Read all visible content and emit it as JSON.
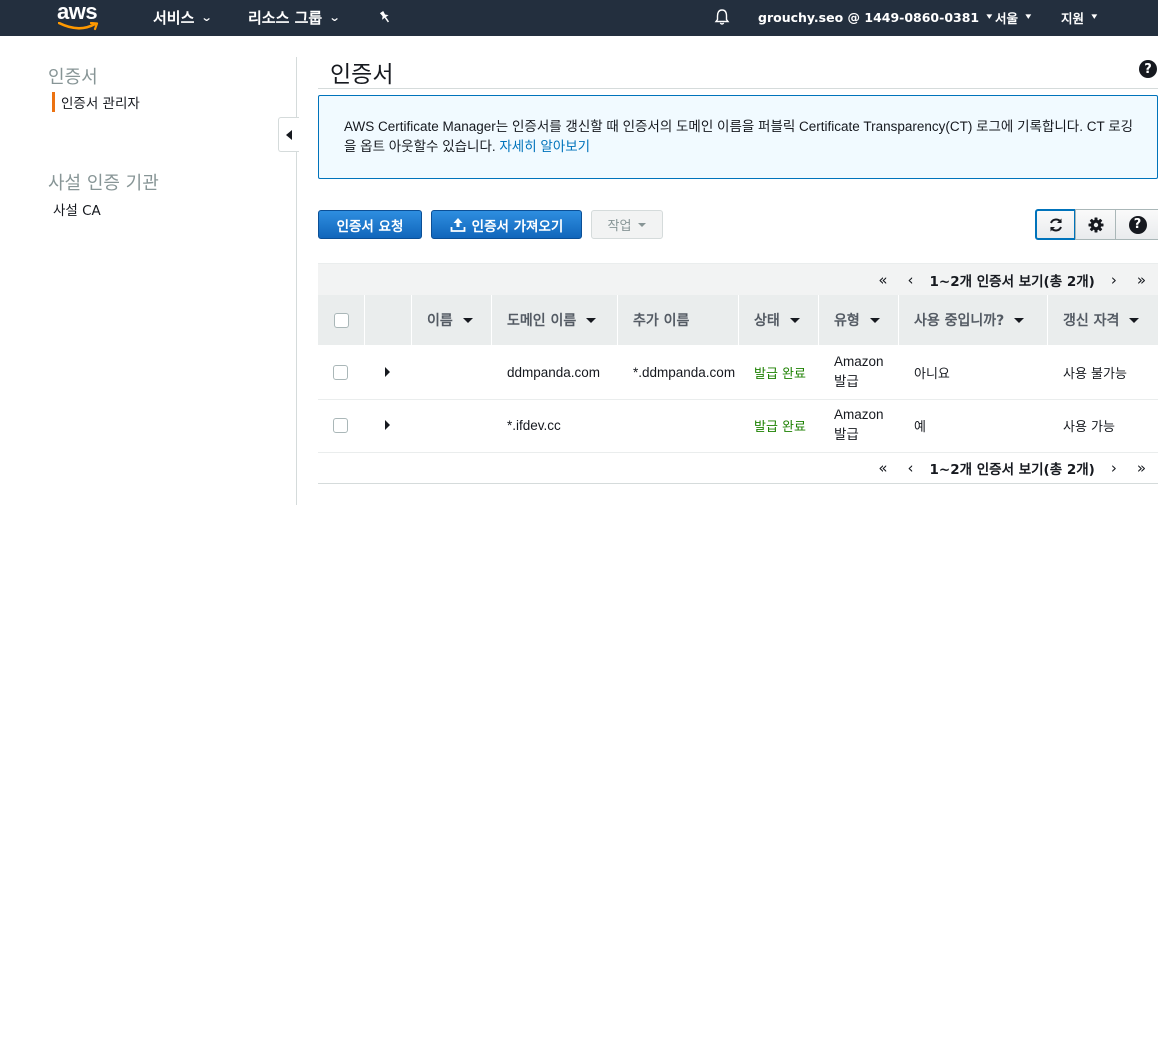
{
  "topnav": {
    "logo_text": "aws",
    "services_label": "서비스",
    "resource_groups_label": "리소스 그룹",
    "account_label": "grouchy.seo @ 1449-0860-0381",
    "region_label": "서울",
    "support_label": "지원"
  },
  "sidebar": {
    "section1_title": "인증서",
    "section1_item": "인증서 관리자",
    "section2_title": "사설 인증 기관",
    "section2_item": "사설 CA"
  },
  "main": {
    "title": "인증서",
    "info_text": "AWS Certificate Manager는 인증서를 갱신할 때 인증서의 도메인 이름을 퍼블릭 Certificate Transparency(CT) 로그에 기록합니다. CT 로깅을 옵트 아웃할수 있습니다.",
    "info_link": "자세히 알아보기",
    "request_button": "인증서 요청",
    "import_button": "인증서 가져오기",
    "actions_button": "작업"
  },
  "table": {
    "pager_text": "1~2개 인증서 보기(총 2개)",
    "columns": [
      "이름",
      "도메인 이름",
      "추가 이름",
      "상태",
      "유형",
      "사용 중입니까?",
      "갱신 자격"
    ],
    "rows": [
      {
        "name": "",
        "domain": "ddmpanda.com",
        "additional": "*.ddmpanda.com",
        "status": "발급 완료",
        "type": "Amazon 발급",
        "in_use": "아니요",
        "renewal": "사용 불가능"
      },
      {
        "name": "",
        "domain": "*.ifdev.cc",
        "additional": "",
        "status": "발급 완료",
        "type": "Amazon 발급",
        "in_use": "예",
        "renewal": "사용 가능"
      }
    ]
  },
  "colors": {
    "nav_bg": "#232f3e",
    "accent_orange": "#ec7211",
    "primary_blue": "#1166bb",
    "status_green": "#1d8102",
    "link_blue": "#0073bb"
  }
}
